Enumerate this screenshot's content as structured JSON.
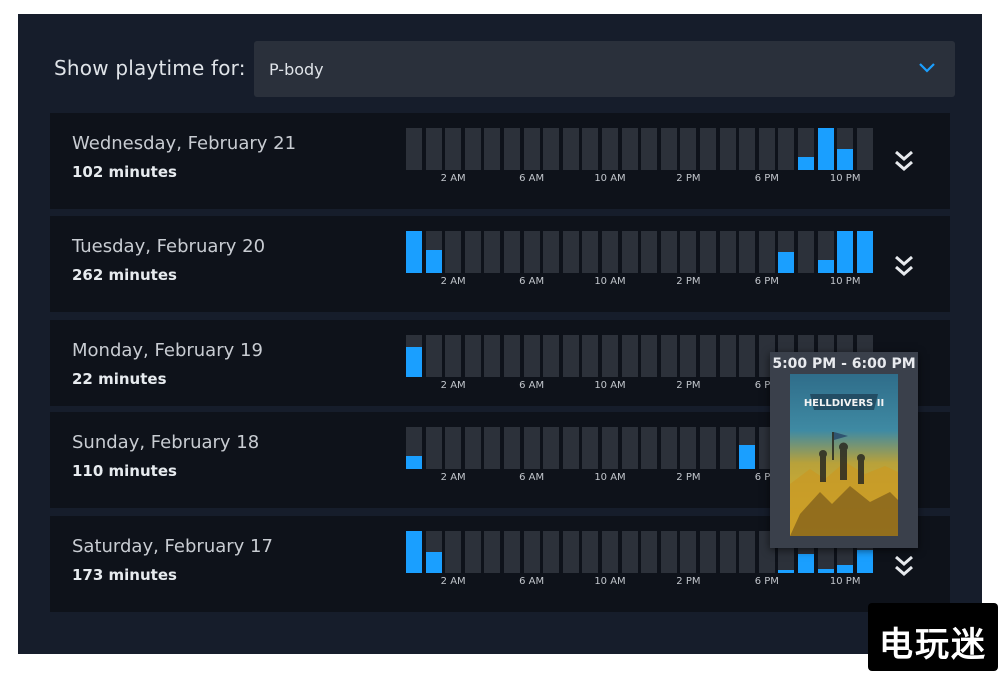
{
  "filter": {
    "label": "Show playtime for:",
    "selected": "P-body"
  },
  "axis_labels": [
    "2 AM",
    "6 AM",
    "10 AM",
    "2 PM",
    "6 PM",
    "10 PM"
  ],
  "days": [
    {
      "date": "Wednesday, February 21",
      "minutes": "102 minutes",
      "hourly_fraction": [
        0,
        0,
        0,
        0,
        0,
        0,
        0,
        0,
        0,
        0,
        0,
        0,
        0,
        0,
        0,
        0,
        0,
        0,
        0,
        0,
        0.3,
        1,
        0.5,
        0
      ]
    },
    {
      "date": "Tuesday, February 20",
      "minutes": "262 minutes",
      "hourly_fraction": [
        1,
        0.55,
        0,
        0,
        0,
        0,
        0,
        0,
        0,
        0,
        0,
        0,
        0,
        0,
        0,
        0,
        0,
        0,
        0,
        0.5,
        0,
        0.32,
        1,
        1
      ]
    },
    {
      "date": "Monday, February 19",
      "minutes": "22 minutes",
      "hourly_fraction": [
        0.72,
        0,
        0,
        0,
        0,
        0,
        0,
        0,
        0,
        0,
        0,
        0,
        0,
        0,
        0,
        0,
        0,
        0,
        0,
        0,
        0,
        0,
        0,
        0
      ]
    },
    {
      "date": "Sunday, February 18",
      "minutes": "110 minutes",
      "hourly_fraction": [
        0.32,
        0,
        0,
        0,
        0,
        0,
        0,
        0,
        0,
        0,
        0,
        0,
        0,
        0,
        0,
        0,
        0,
        0.58,
        0,
        0,
        0,
        0,
        0,
        0
      ]
    },
    {
      "date": "Saturday, February 17",
      "minutes": "173 minutes",
      "hourly_fraction": [
        1,
        0.5,
        0,
        0,
        0,
        0,
        0,
        0,
        0,
        0,
        0,
        0,
        0,
        0,
        0,
        0,
        0,
        0,
        0,
        0.08,
        0.45,
        0.1,
        0.18,
        0.55
      ]
    }
  ],
  "tooltip": {
    "time_range": "5:00 PM - 6:00 PM",
    "game_logo": "HELLDIVERS II"
  },
  "watermark": "电玩迷",
  "colors": {
    "accent": "#1a9fff",
    "bar_empty": "#2c313a",
    "panel": "#161d2b",
    "row": "#0e121a"
  }
}
